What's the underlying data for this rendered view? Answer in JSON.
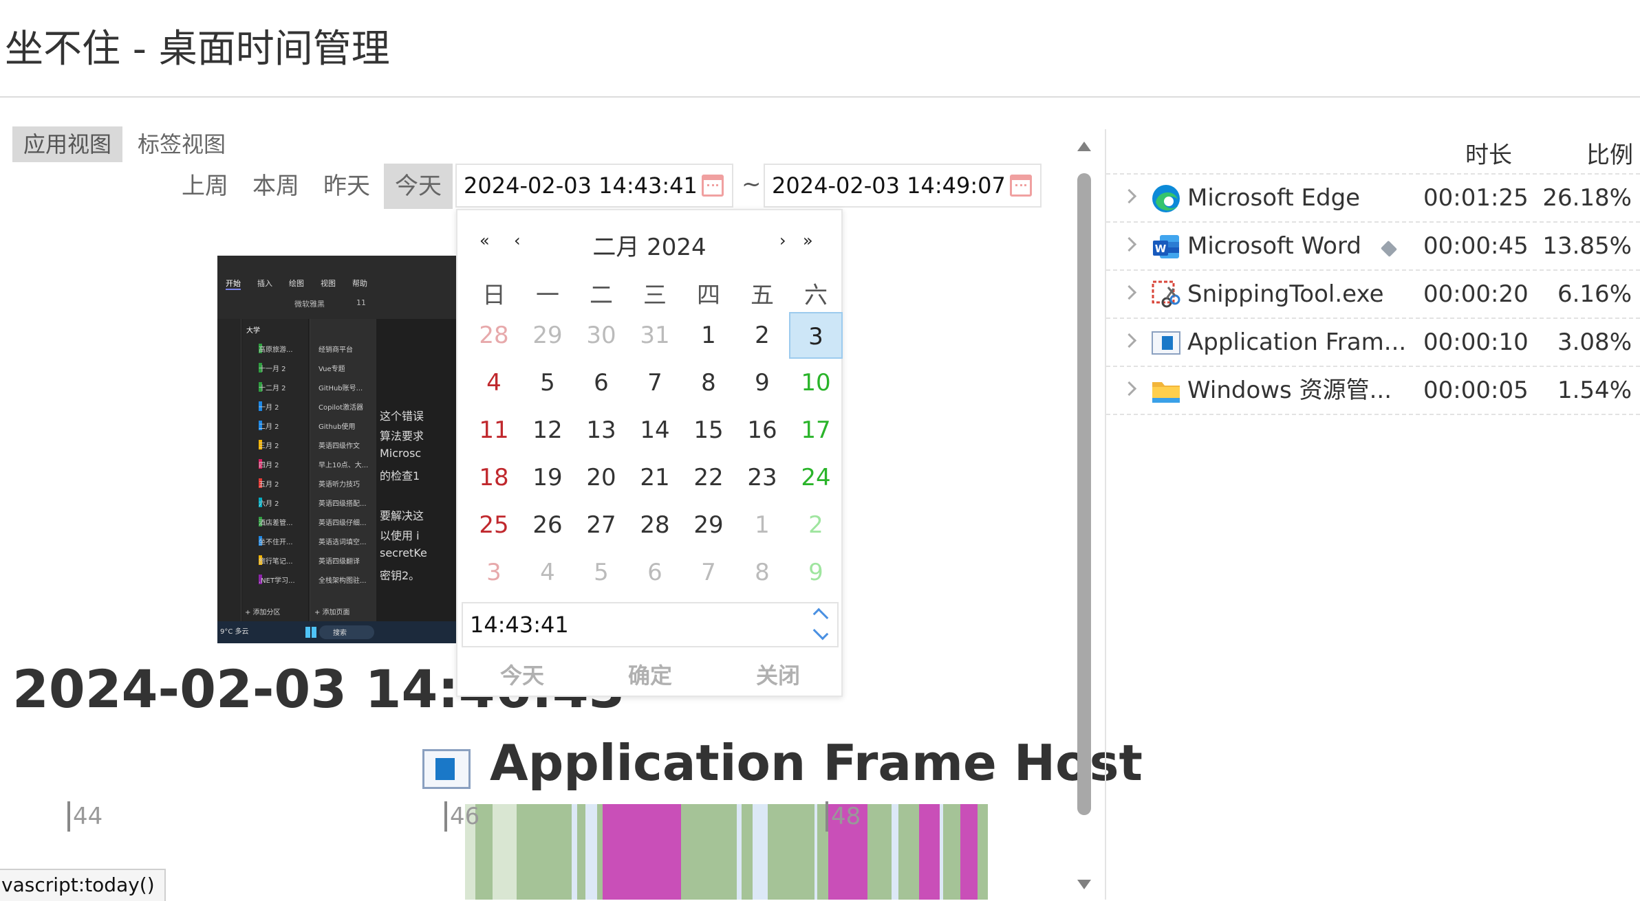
{
  "window": {
    "title": "坐不住 - 桌面时间管理"
  },
  "view_tabs": [
    {
      "label": "应用视图",
      "active": true
    },
    {
      "label": "标签视图",
      "active": false
    }
  ],
  "range_buttons": [
    {
      "label": "上周",
      "active": false
    },
    {
      "label": "本周",
      "active": false
    },
    {
      "label": "昨天",
      "active": false
    },
    {
      "label": "今天",
      "active": true
    }
  ],
  "date_range": {
    "start": "2024-02-03 14:43:41",
    "separator": "~",
    "end": "2024-02-03 14:49:07"
  },
  "calendar": {
    "title": "二月 2024",
    "nav": {
      "prev_year": "«",
      "prev_month": "‹",
      "next_month": "›",
      "next_year": "»"
    },
    "weekdays": [
      "日",
      "一",
      "二",
      "三",
      "四",
      "五",
      "六"
    ],
    "weeks": [
      [
        {
          "d": "28",
          "o": true
        },
        {
          "d": "29",
          "o": true
        },
        {
          "d": "30",
          "o": true
        },
        {
          "d": "31",
          "o": true
        },
        {
          "d": "1"
        },
        {
          "d": "2"
        },
        {
          "d": "3",
          "sel": true
        }
      ],
      [
        {
          "d": "4"
        },
        {
          "d": "5"
        },
        {
          "d": "6"
        },
        {
          "d": "7"
        },
        {
          "d": "8"
        },
        {
          "d": "9"
        },
        {
          "d": "10"
        }
      ],
      [
        {
          "d": "11"
        },
        {
          "d": "12"
        },
        {
          "d": "13"
        },
        {
          "d": "14"
        },
        {
          "d": "15"
        },
        {
          "d": "16"
        },
        {
          "d": "17"
        }
      ],
      [
        {
          "d": "18"
        },
        {
          "d": "19"
        },
        {
          "d": "20"
        },
        {
          "d": "21"
        },
        {
          "d": "22"
        },
        {
          "d": "23"
        },
        {
          "d": "24"
        }
      ],
      [
        {
          "d": "25"
        },
        {
          "d": "26"
        },
        {
          "d": "27"
        },
        {
          "d": "28"
        },
        {
          "d": "29"
        },
        {
          "d": "1",
          "o": true
        },
        {
          "d": "2",
          "o": true
        }
      ],
      [
        {
          "d": "3",
          "o": true
        },
        {
          "d": "4",
          "o": true
        },
        {
          "d": "5",
          "o": true
        },
        {
          "d": "6",
          "o": true
        },
        {
          "d": "7",
          "o": true
        },
        {
          "d": "8",
          "o": true
        },
        {
          "d": "9",
          "o": true
        }
      ]
    ],
    "time": "14:43:41",
    "buttons": {
      "today": "今天",
      "confirm": "确定",
      "close": "关闭"
    }
  },
  "screenshot_preview": {
    "ribbon_tabs": [
      "开始",
      "插入",
      "绘图",
      "视图",
      "帮助"
    ],
    "font_name": "微软雅黑",
    "font_size": "11",
    "notebook": "大学",
    "sections": [
      {
        "name": "高原旅游...",
        "color": "#2e9e3f"
      },
      {
        "name": "十一月 2",
        "color": "#2e9e3f"
      },
      {
        "name": "十二月 2",
        "color": "#2e9e3f"
      },
      {
        "name": "一月 2",
        "color": "#1e88e5"
      },
      {
        "name": "二月 2",
        "color": "#1e88e5"
      },
      {
        "name": "三月 2",
        "color": "#f4b400"
      },
      {
        "name": "四月 2",
        "color": "#d81b60"
      },
      {
        "name": "五月 2",
        "color": "#e53935"
      },
      {
        "name": "六月 2",
        "color": "#00acc1"
      },
      {
        "name": "酒店差管...",
        "color": "#2e9e3f"
      },
      {
        "name": "坐不住开...",
        "color": "#1e88e5"
      },
      {
        "name": "旅行笔记...",
        "color": "#f4b400"
      },
      {
        "name": ".NET学习...",
        "color": "#8e24aa"
      }
    ],
    "pages": [
      "经销商平台",
      "Vue专题",
      "GitHub账号...",
      "Copilot激活器",
      "Github使用",
      "英语四级作文",
      "早上10点、大...",
      "英语听力技巧",
      "英语四级搭配...",
      "英语四级仔细...",
      "英语选词填空...",
      "英语四级翻译",
      "全栈架构图驻..."
    ],
    "add_section": "+ 添加分区",
    "add_page": "+ 添加页面",
    "note_lines": [
      "这个错误",
      "算法要求",
      "Microsc",
      "的检查1",
      "",
      "要解决这",
      "以使用 i",
      "secretKe",
      "密钥2。"
    ],
    "weather": "9°C 多云",
    "taskbar_search": "搜索"
  },
  "selected_time": "2024-02-03 14:46:43",
  "selected_app": {
    "icon": "application-frame-icon",
    "name": "Application Frame Host"
  },
  "timeline": {
    "labels": [
      "44",
      "46",
      "48"
    ],
    "colors": {
      "green": "#a5c397",
      "magenta": "#c94fb8",
      "pale_blue": "#dce8f6",
      "pale_green": "#d9e6d2"
    },
    "segments": [
      {
        "start": 0.0,
        "end": 0.015,
        "c": "pale_green"
      },
      {
        "start": 0.015,
        "end": 0.04,
        "c": "green"
      },
      {
        "start": 0.04,
        "end": 0.075,
        "c": "pale_green"
      },
      {
        "start": 0.075,
        "end": 0.155,
        "c": "green"
      },
      {
        "start": 0.155,
        "end": 0.163,
        "c": "pale_blue"
      },
      {
        "start": 0.163,
        "end": 0.175,
        "c": "green"
      },
      {
        "start": 0.175,
        "end": 0.192,
        "c": "pale_blue"
      },
      {
        "start": 0.192,
        "end": 0.2,
        "c": "green"
      },
      {
        "start": 0.2,
        "end": 0.314,
        "c": "magenta"
      },
      {
        "start": 0.314,
        "end": 0.395,
        "c": "green"
      },
      {
        "start": 0.395,
        "end": 0.402,
        "c": "pale_blue"
      },
      {
        "start": 0.402,
        "end": 0.418,
        "c": "green"
      },
      {
        "start": 0.418,
        "end": 0.44,
        "c": "pale_blue"
      },
      {
        "start": 0.44,
        "end": 0.508,
        "c": "green"
      },
      {
        "start": 0.508,
        "end": 0.512,
        "c": "pale_blue"
      },
      {
        "start": 0.512,
        "end": 0.528,
        "c": "green"
      },
      {
        "start": 0.528,
        "end": 0.585,
        "c": "magenta"
      },
      {
        "start": 0.585,
        "end": 0.62,
        "c": "green"
      },
      {
        "start": 0.62,
        "end": 0.63,
        "c": "pale_blue"
      },
      {
        "start": 0.63,
        "end": 0.66,
        "c": "green"
      },
      {
        "start": 0.66,
        "end": 0.69,
        "c": "magenta"
      },
      {
        "start": 0.69,
        "end": 0.695,
        "c": "pale_blue"
      },
      {
        "start": 0.695,
        "end": 0.72,
        "c": "green"
      },
      {
        "start": 0.72,
        "end": 0.745,
        "c": "magenta"
      },
      {
        "start": 0.745,
        "end": 0.76,
        "c": "green"
      }
    ]
  },
  "app_table": {
    "headers": {
      "duration": "时长",
      "ratio": "比例"
    },
    "rows": [
      {
        "icon": "edge-icon",
        "name": "Microsoft Edge",
        "duration": "00:01:25",
        "ratio": "26.18%",
        "tagged": false
      },
      {
        "icon": "word-icon",
        "name": "Microsoft Word",
        "duration": "00:00:45",
        "ratio": "13.85%",
        "tagged": true
      },
      {
        "icon": "snipping-tool-icon",
        "name": "SnippingTool.exe",
        "duration": "00:00:20",
        "ratio": "6.16%",
        "tagged": false
      },
      {
        "icon": "application-frame-icon",
        "name": "Application Fram...",
        "duration": "00:00:10",
        "ratio": "3.08%",
        "tagged": false
      },
      {
        "icon": "folder-icon",
        "name": "Windows 资源管...",
        "duration": "00:00:05",
        "ratio": "1.54%",
        "tagged": false
      }
    ]
  },
  "status_bar": {
    "link": "vascript:today()"
  }
}
